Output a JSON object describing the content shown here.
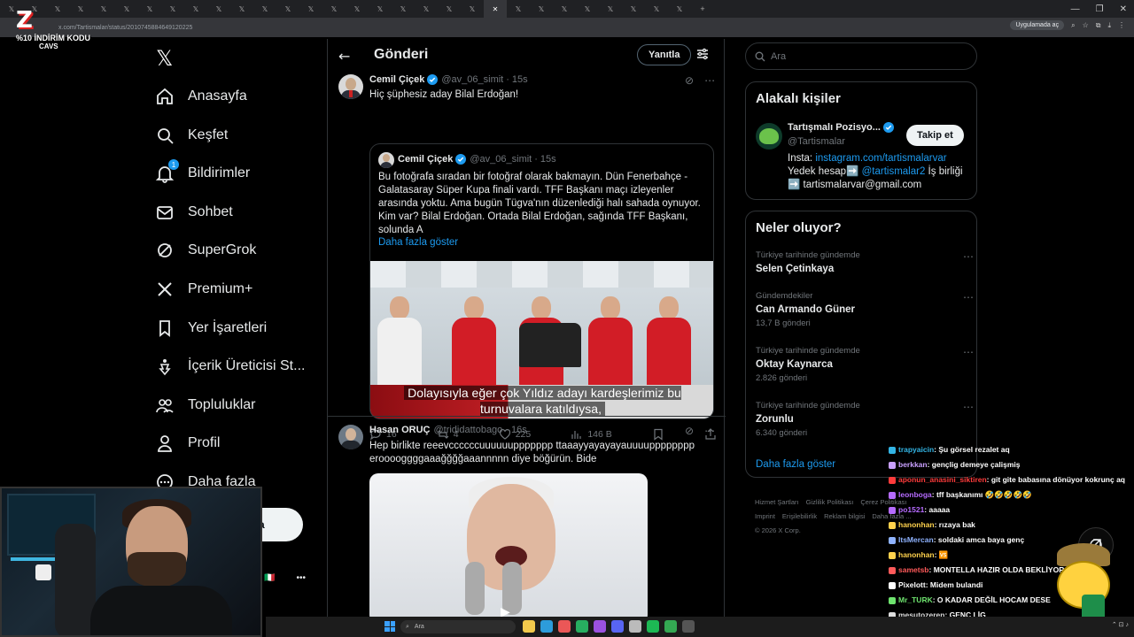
{
  "browser": {
    "tab_count": 30,
    "url": "x.com/Tartismalar/status/2010745884649120225",
    "open_in_app_label": "Uygulamada aç"
  },
  "stream_overlay": {
    "logo_text": "Z",
    "promo_text": "%10 İNDİRİM KODU",
    "promo_code": "CAVS"
  },
  "nav": {
    "items": [
      {
        "label": "Anasayfa",
        "icon": "home-icon"
      },
      {
        "label": "Keşfet",
        "icon": "search-icon"
      },
      {
        "label": "Bildirimler",
        "icon": "bell-icon",
        "badge": "1"
      },
      {
        "label": "Sohbet",
        "icon": "mail-icon"
      },
      {
        "label": "SuperGrok",
        "icon": "grok-icon"
      },
      {
        "label": "Premium+",
        "icon": "x-icon"
      },
      {
        "label": "Yer İşaretleri",
        "icon": "bookmark-icon"
      },
      {
        "label": "İçerik Üreticisi St...",
        "icon": "creator-icon"
      },
      {
        "label": "Topluluklar",
        "icon": "communities-icon"
      },
      {
        "label": "Profil",
        "icon": "profile-icon"
      },
      {
        "label": "Daha fazla",
        "icon": "more-icon"
      }
    ],
    "post_button_label": "a"
  },
  "center": {
    "title": "Gönderi",
    "reply_button": "Yanıtla",
    "post1": {
      "name": "Cemil Çiçek",
      "handle": "@av_06_simit",
      "time": "15s",
      "text": "Hiç şüphesiz aday Bilal Erdoğan!",
      "quote": {
        "name": "Cemil Çiçek",
        "handle": "@av_06_simit",
        "time": "15s",
        "text": "Bu fotoğrafa sıradan bir fotoğraf olarak bakmayın. Dün Fenerbahçe - Galatasaray Süper Kupa finali vardı. TFF Başkanı maçı izleyenler arasında yoktu. Ama bugün Tügva'nın düzenlediği halı sahada oynuyor. Kim var? Bilal Erdoğan. Ortada Bilal Erdoğan, sağında TFF Başkanı, solunda A",
        "show_more": "Daha fazla göster",
        "video_subtitle": "Dolayısıyla eğer çok Yıldız adayı kardeşlerimiz bu turnuvalara katıldıysa,"
      },
      "stats": {
        "replies": "16",
        "reposts": "4",
        "likes": "225",
        "views": "146 B"
      }
    },
    "post2": {
      "name": "Hasan ORUÇ",
      "handle": "@trididattobago",
      "time": "16s",
      "text": "Hep birlikte reeevccccccuuuuuuppppppp ttaaayyayayayauuuupppppppp erooooggggaaağğğğaaannnnn diye böğürün. Bide"
    }
  },
  "right": {
    "search_placeholder": "Ara",
    "relevant": {
      "title": "Alakalı kişiler",
      "name": "Tartışmalı Pozisyo...",
      "handle": "@Tartismalar",
      "follow_label": "Takip et",
      "bio_prefix": "Insta: ",
      "bio_link": "instagram.com/tartismalarvar",
      "bio_mid": "Yedek hesap➡️ ",
      "bio_link2": "@tartismalar2",
      "bio_after": " İş birliği ➡️ tartismalarvar@gmail.com"
    },
    "trends": {
      "title": "Neler oluyor?",
      "items": [
        {
          "context": "Türkiye tarihinde gündemde",
          "name": "Selen Çetinkaya",
          "count": ""
        },
        {
          "context": "Gündemdekiler",
          "name": "Can Armando Güner",
          "count": "13,7 B gönderi"
        },
        {
          "context": "Türkiye tarihinde gündemde",
          "name": "Oktay Kaynarca",
          "count": "2.826 gönderi"
        },
        {
          "context": "Türkiye tarihinde gündemde",
          "name": "Zorunlu",
          "count": "6.340 gönderi"
        }
      ],
      "show_more": "Daha fazla göster"
    },
    "footer": {
      "links": [
        "Hizmet Şartları",
        "Gizlilik Politikası",
        "Çerez Politikası",
        "Imprint",
        "Erişilebilirlik",
        "Reklam bilgisi",
        "Daha fazla ..."
      ],
      "copyright": "© 2026 X Corp."
    }
  },
  "chat": {
    "messages": [
      {
        "user": "trapyaicin",
        "text": ": Şu görsel rezalet aq",
        "color": "#33b5e5"
      },
      {
        "user": "berkkan",
        "text": ": gençlig demeye çalişmiş",
        "color": "#c9a0ff"
      },
      {
        "user": "aponun_anasini_siktiren",
        "text": ": git gite babasına dönüyor kokrunç aq",
        "color": "#ff3b3b"
      },
      {
        "user": "leonboga",
        "text": ": tff başkanımı 🤣🤣🤣🤣🤣",
        "color": "#b66bff"
      },
      {
        "user": "po1521",
        "text": ": aaaaa",
        "color": "#b66bff"
      },
      {
        "user": "hanonhan",
        "text": ": rızaya bak",
        "color": "#ffd24d"
      },
      {
        "user": "ItsMercan",
        "text": ": soldaki amca baya genç",
        "color": "#8fb3ff"
      },
      {
        "user": "hanonhan",
        "text": ": 🆚",
        "color": "#ffd24d"
      },
      {
        "user": "sametsb",
        "text": ": MONTELLA HAZIR OLDA BEKLİYOR AQ",
        "color": "#ff5a5a"
      },
      {
        "user": "Pixelott",
        "text": ": Midem bulandi",
        "color": "#ffffff"
      },
      {
        "user": "Mr_TURK",
        "text": ": O KADAR DEĞİL HOCAM DESE",
        "color": "#6ee36e"
      },
      {
        "user": "mesutozeren",
        "text": ": GENÇ LİG",
        "color": "#dddddd"
      }
    ]
  },
  "taskbar": {
    "search_placeholder": "Ara"
  }
}
